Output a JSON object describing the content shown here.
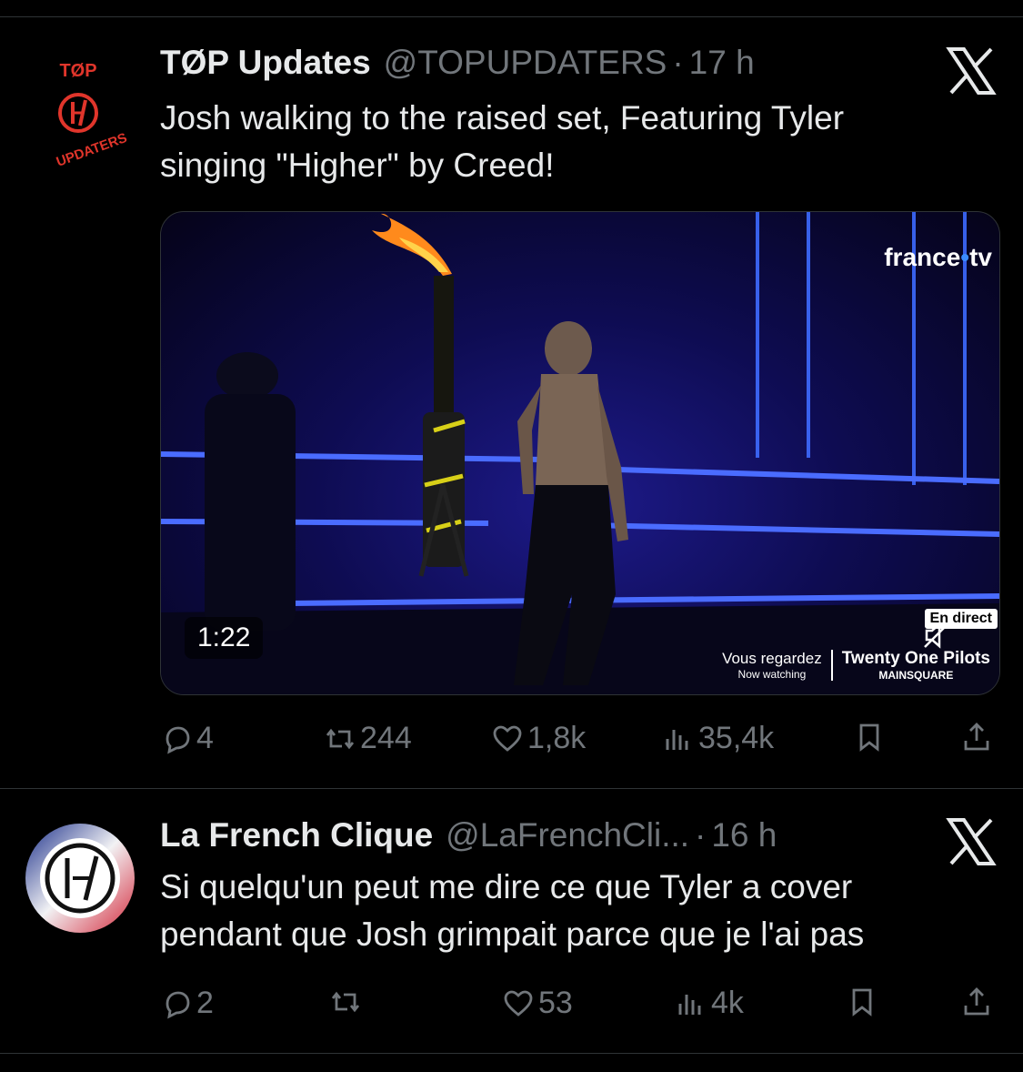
{
  "tweets": [
    {
      "avatar_label_top": "TØP",
      "avatar_label_bottom": "UPDATERS",
      "name": "TØP Updates",
      "handle": "@TOPUPDATERS",
      "separator": "·",
      "time": "17 h",
      "text_line1": "Josh walking to the raised set, Featuring Tyler",
      "text_line2": "singing \"Higher\" by Creed!",
      "media": {
        "duration": "1:22",
        "broadcaster_main": "france",
        "broadcaster_dot": "•",
        "broadcaster_tail": "tv",
        "live_badge": "En direct",
        "now_watching_fr": "Vous regardez",
        "now_watching_en": "Now watching",
        "band_name": "Twenty One Pilots",
        "festival": "MAINSQUARE"
      },
      "stats": {
        "replies": "4",
        "retweets": "244",
        "likes": "1,8k",
        "views": "35,4k"
      }
    },
    {
      "name": "La French Clique",
      "handle": "@LaFrenchCli...",
      "separator": "·",
      "time": "16 h",
      "text_line1": "Si quelqu'un peut me dire ce que Tyler a cover",
      "text_line2": "pendant que Josh grimpait parce que je l'ai pas",
      "stats": {
        "replies": "2",
        "retweets": "",
        "likes": "53",
        "views": "4k"
      }
    }
  ],
  "colors": {
    "background": "#000000",
    "muted": "#71767b",
    "text": "#e7e9ea",
    "accent_red": "#e0352b"
  }
}
